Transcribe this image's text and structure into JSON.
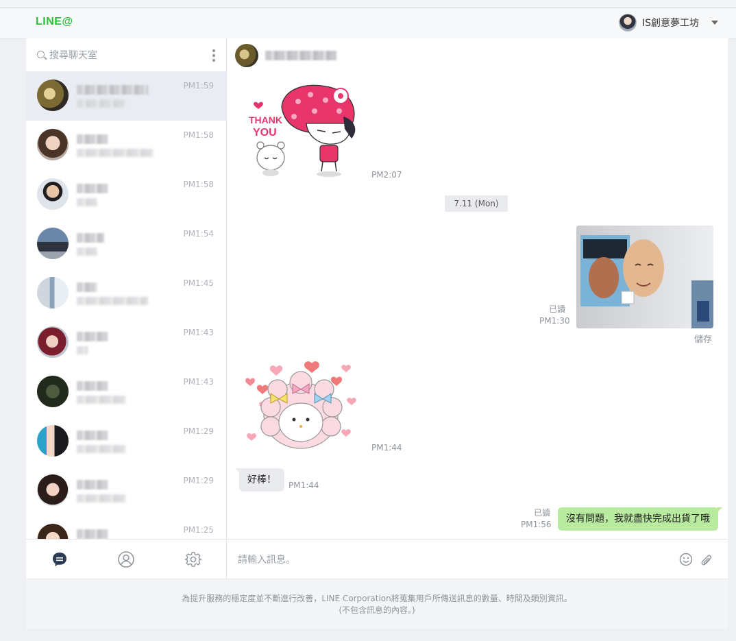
{
  "header": {
    "logo": "LINE@",
    "account_name": "IS創意夢工坊"
  },
  "sidebar": {
    "search_placeholder": "搜尋聊天室",
    "chats": [
      {
        "time": "PM1:59",
        "active": true
      },
      {
        "time": "PM1:58"
      },
      {
        "time": "PM1:58"
      },
      {
        "time": "PM1:54"
      },
      {
        "time": "PM1:45"
      },
      {
        "time": "PM1:43"
      },
      {
        "time": "PM1:43"
      },
      {
        "time": "PM1:29"
      },
      {
        "time": "PM1:29"
      },
      {
        "time": "PM1:25"
      }
    ],
    "tabs": [
      "chat-icon",
      "friends-icon",
      "settings-icon"
    ]
  },
  "chat": {
    "messages": {
      "sticker1_text_top": "THANK",
      "sticker1_text_bottom": "YOU",
      "sticker1_time": "PM2:07",
      "date_divider": "7.11 (Mon)",
      "photo_read": "已讀",
      "photo_time": "PM1:30",
      "photo_save": "儲存",
      "sticker2_time": "PM1:44",
      "incoming_text": "好棒！",
      "incoming_time": "PM1:44",
      "outgoing_read": "已讀",
      "outgoing_time": "PM1:56",
      "outgoing_text": "沒有問題，我就盡快完成出貨了哦"
    },
    "composer_placeholder": "請輸入訊息。"
  },
  "footer": {
    "line1": "為提升服務的穩定度並不斷進行改善，LINE Corporation將蒐集用戶所傳送訊息的數量、時間及類別資訊。",
    "line2": "(不包含訊息的內容。)"
  },
  "colors": {
    "brand": "#2cc13b",
    "outgoing_bubble": "#b8ea9f",
    "incoming_bubble": "#e9ebee"
  }
}
